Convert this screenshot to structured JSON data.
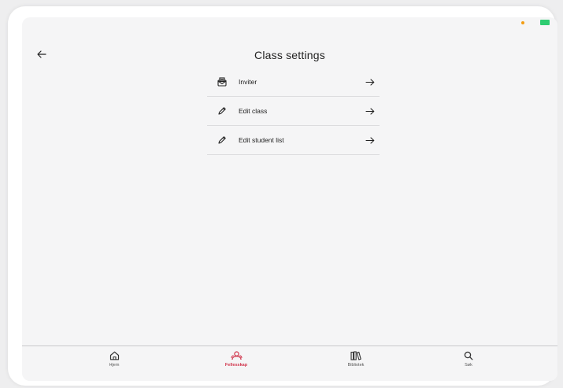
{
  "header": {
    "title": "Class settings",
    "back_icon": "arrow-left-icon"
  },
  "settings": {
    "items": [
      {
        "label": "Inviter",
        "icon": "envelope-open-icon"
      },
      {
        "label": "Edit class",
        "icon": "pencil-icon"
      },
      {
        "label": "Edit student list",
        "icon": "pencil-icon"
      }
    ]
  },
  "tab_bar": {
    "items": [
      {
        "label": "Hjem",
        "icon": "home-icon",
        "active": false
      },
      {
        "label": "Fellesskap",
        "icon": "community-icon",
        "active": true
      },
      {
        "label": "Bibliotek",
        "icon": "library-icon",
        "active": false
      },
      {
        "label": "Søk",
        "icon": "search-icon",
        "active": false
      }
    ]
  },
  "colors": {
    "accent": "#d0334a",
    "text": "#222222",
    "background": "#f5f5f6",
    "status_orange": "#f39c12",
    "status_green": "#2ecc71"
  }
}
